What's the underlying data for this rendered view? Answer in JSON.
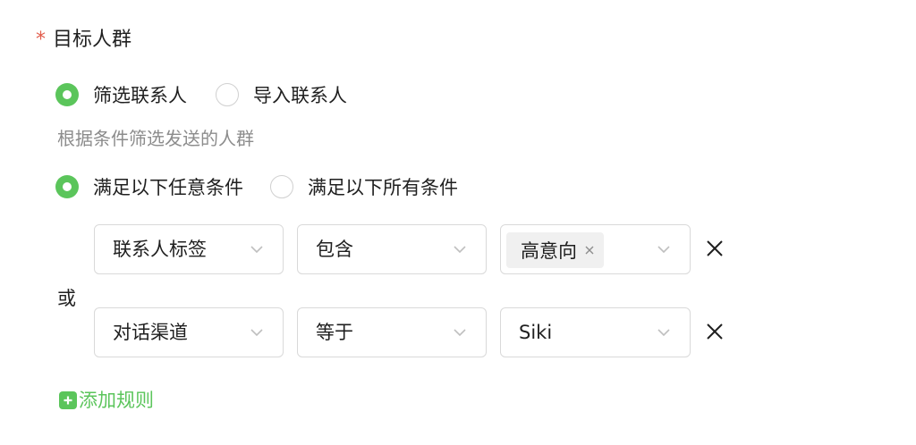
{
  "audience": {
    "label": "目标人群",
    "required_mark": "*"
  },
  "source_mode": {
    "options": [
      {
        "label": "筛选联系人",
        "checked": true
      },
      {
        "label": "导入联系人",
        "checked": false
      }
    ]
  },
  "helper_text": "根据条件筛选发送的人群",
  "match_mode": {
    "options": [
      {
        "label": "满足以下任意条件",
        "checked": true
      },
      {
        "label": "满足以下所有条件",
        "checked": false
      }
    ]
  },
  "logic_label": "或",
  "rules": [
    {
      "field": "联系人标签",
      "operator": "包含",
      "value_tags": [
        "高意向"
      ]
    },
    {
      "field": "对话渠道",
      "operator": "等于",
      "value": "Siki"
    }
  ],
  "add_rule_label": "添加规则",
  "colors": {
    "accent": "#5bc55b",
    "required": "#e25b4a",
    "helper_text": "#8c8c8c",
    "border": "#d9d9d9",
    "tag_bg": "#f0f0f0"
  },
  "icons": {
    "dropdown": "chevron-down-icon",
    "tag_close": "close-icon",
    "remove_rule": "close-icon",
    "add_rule": "plus-square-icon"
  }
}
